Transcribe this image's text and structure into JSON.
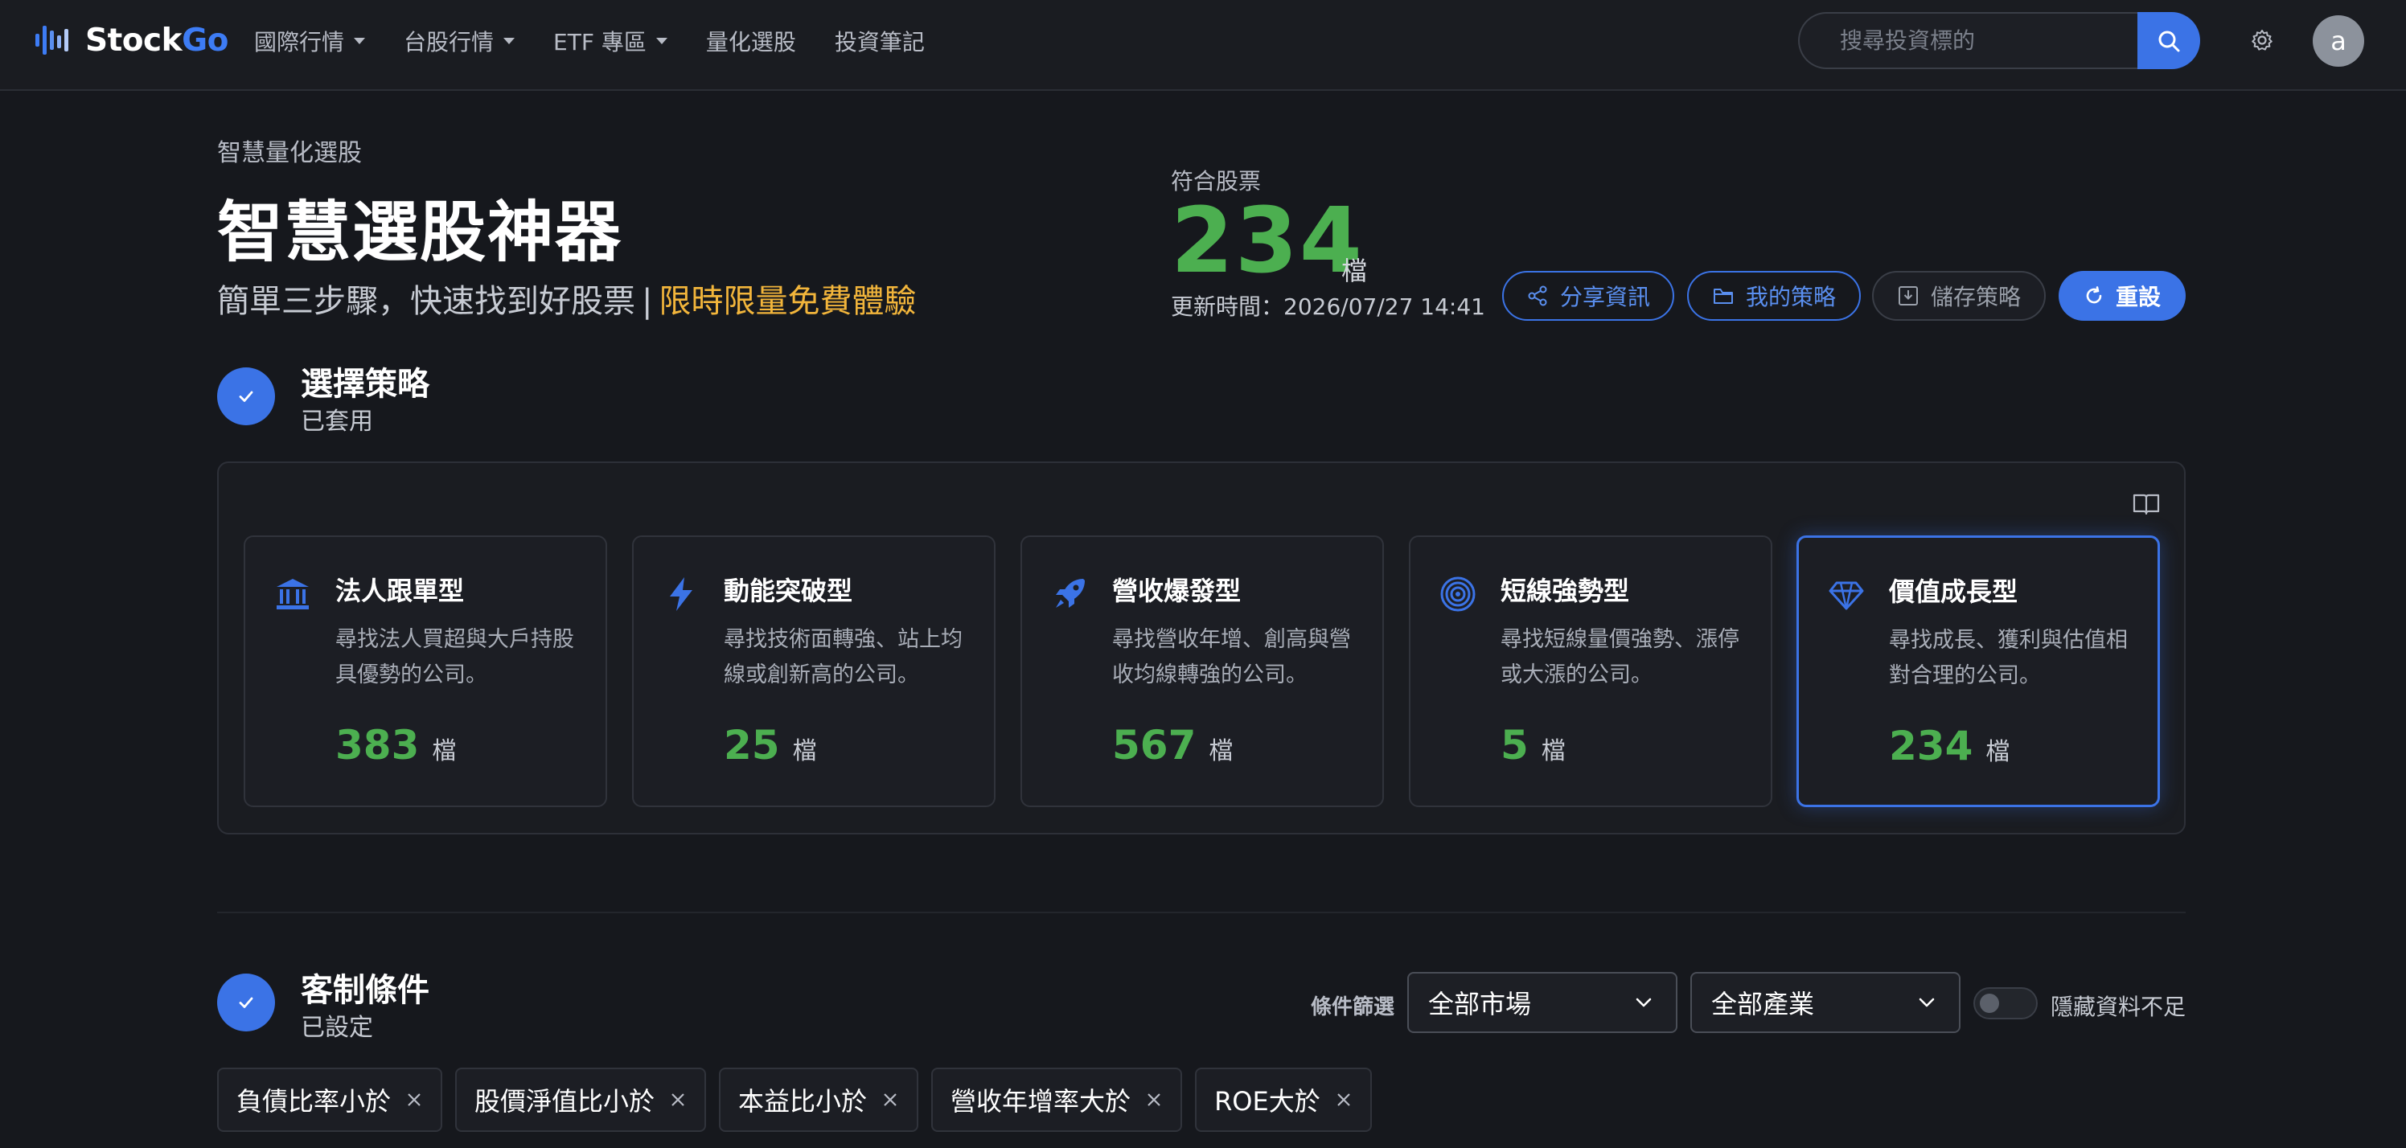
{
  "nav": {
    "brand": {
      "name_prefix": "Stock",
      "name_suffix": "Go"
    },
    "items": [
      {
        "label": "國際行情",
        "dropdown": true
      },
      {
        "label": "台股行情",
        "dropdown": true
      },
      {
        "label": "ETF 專區",
        "dropdown": true
      },
      {
        "label": "量化選股",
        "dropdown": false
      },
      {
        "label": "投資筆記",
        "dropdown": false
      }
    ],
    "search_placeholder": "搜尋投資標的",
    "search_icon": "search-icon",
    "settings_icon": "gear-icon",
    "avatar_letter": "a"
  },
  "header": {
    "eyebrow": "智慧量化選股",
    "title": "智慧選股神器",
    "subtitle_main": "簡單三步驟，快速找到好股票",
    "subtitle_sep": "|",
    "subtitle_promo": "限時限量免費體驗",
    "match_label": "符合股票",
    "match_count": "234",
    "match_unit": "檔",
    "updated": "更新時間：2026/07/27 14:41",
    "actions": {
      "share": "分享資訊",
      "my_strategy": "我的策略",
      "save": "儲存策略",
      "reset": "重設"
    }
  },
  "step1": {
    "title": "選擇策略",
    "status": "已套用",
    "strategies": [
      {
        "icon": "bank-icon",
        "title": "法人跟單型",
        "desc": "尋找法人買超與大戶持股具優勢的公司。",
        "count": "383",
        "unit": "檔",
        "active": false
      },
      {
        "icon": "lightning-icon",
        "title": "動能突破型",
        "desc": "尋找技術面轉強、站上均線或創新高的公司。",
        "count": "25",
        "unit": "檔",
        "active": false
      },
      {
        "icon": "rocket-icon",
        "title": "營收爆發型",
        "desc": "尋找營收年增、創高與營收均線轉強的公司。",
        "count": "567",
        "unit": "檔",
        "active": false
      },
      {
        "icon": "target-icon",
        "title": "短線強勢型",
        "desc": "尋找短線量價強勢、漲停或大漲的公司。",
        "count": "5",
        "unit": "檔",
        "active": false
      },
      {
        "icon": "diamond-icon",
        "title": "價值成長型",
        "desc": "尋找成長、獲利與估值相對合理的公司。",
        "count": "234",
        "unit": "檔",
        "active": true
      }
    ]
  },
  "step2": {
    "title": "客制條件",
    "status": "已設定",
    "filter_label": "條件篩選",
    "market_select": "全部市場",
    "industry_select": "全部產業",
    "hide_insufficient_label": "隱藏資料不足",
    "hide_insufficient_on": false,
    "chips": [
      "負債比率小於",
      "股價淨值比小於",
      "本益比小於",
      "營收年增率大於",
      "ROE大於"
    ]
  },
  "colors": {
    "accent": "#3b73e6",
    "positive": "#4caf50",
    "promo": "#f2b53b",
    "background": "#16181d"
  }
}
